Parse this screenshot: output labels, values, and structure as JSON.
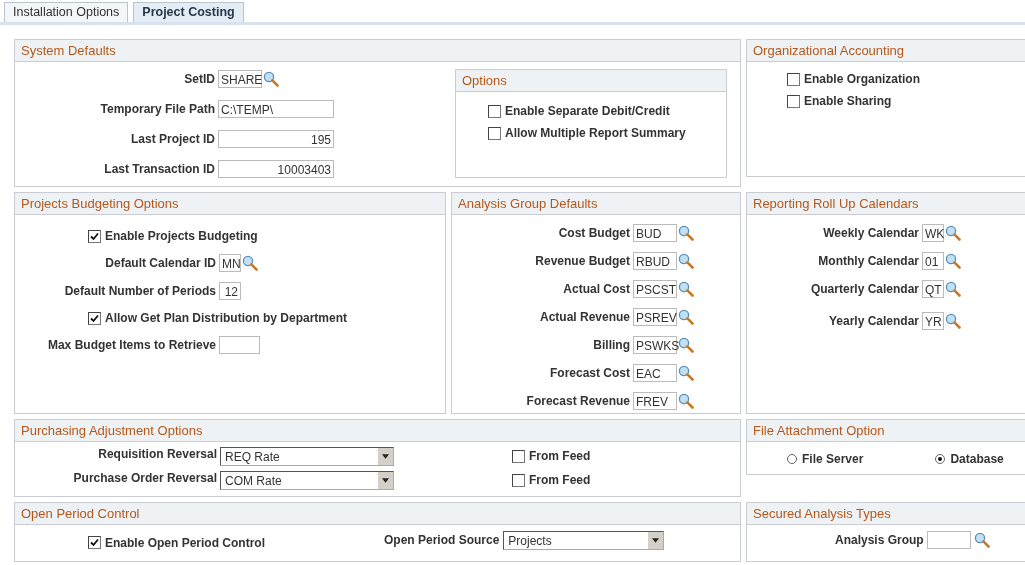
{
  "tabs": [
    {
      "label": "Installation Options",
      "selected": false
    },
    {
      "label": "Project Costing",
      "selected": true
    }
  ],
  "system_defaults": {
    "title": "System Defaults",
    "fields": [
      {
        "label": "SetID",
        "value": "SHARE",
        "kind": "lookup"
      },
      {
        "label": "Temporary File Path",
        "value": "C:\\TEMP\\",
        "kind": "text"
      },
      {
        "label": "Last Project ID",
        "value": "195",
        "kind": "number"
      },
      {
        "label": "Last Transaction ID",
        "value": "10003403",
        "kind": "number"
      }
    ],
    "options": {
      "title": "Options",
      "checkboxes": [
        {
          "label": "Enable Separate Debit/Credit",
          "checked": false
        },
        {
          "label": "Allow Multiple Report Summary",
          "checked": false
        }
      ]
    }
  },
  "organizational_accounting": {
    "title": "Organizational Accounting",
    "checkboxes": [
      {
        "label": "Enable Organization",
        "checked": false
      },
      {
        "label": "Enable Sharing",
        "checked": false
      }
    ]
  },
  "projects_budgeting": {
    "title": "Projects Budgeting Options",
    "items": [
      {
        "kind": "checkbox",
        "label": "Enable Projects Budgeting",
        "checked": true
      },
      {
        "kind": "lookup",
        "label": "Default Calendar ID",
        "value": "MN"
      },
      {
        "kind": "number",
        "label": "Default Number of Periods",
        "value": "12"
      },
      {
        "kind": "checkbox",
        "label": "Allow Get Plan Distribution by Department",
        "checked": true
      },
      {
        "kind": "text",
        "label": "Max Budget Items to Retrieve"
      }
    ]
  },
  "analysis_group_defaults": {
    "title": "Analysis Group Defaults",
    "fields": [
      {
        "label": "Cost Budget",
        "value": "BUD"
      },
      {
        "label": "Revenue Budget",
        "value": "RBUD"
      },
      {
        "label": "Actual Cost",
        "value": "PSCST"
      },
      {
        "label": "Actual Revenue",
        "value": "PSREV"
      },
      {
        "label": "Billing",
        "value": "PSWKS"
      },
      {
        "label": "Forecast Cost",
        "value": "EAC"
      },
      {
        "label": "Forecast Revenue",
        "value": "FREV"
      }
    ]
  },
  "reporting_roll_up_calendars": {
    "title": "Reporting Roll Up Calendars",
    "fields": [
      {
        "label": "Weekly Calendar",
        "value": "WK"
      },
      {
        "label": "Monthly Calendar",
        "value": "01"
      },
      {
        "label": "Quarterly Calendar",
        "value": "QT"
      },
      {
        "label": "Yearly Calendar",
        "value": "YR"
      }
    ]
  },
  "purchasing_adjustment": {
    "title": "Purchasing Adjustment Options",
    "rows": [
      {
        "label": "Requisition Reversal",
        "value": "REQ Rate",
        "from_feed": {
          "label": "From Feed",
          "checked": false
        }
      },
      {
        "label": "Purchase Order Reversal",
        "value": "COM Rate",
        "from_feed": {
          "label": "From Feed",
          "checked": false
        }
      }
    ]
  },
  "file_attachment": {
    "title": "File Attachment Option",
    "options": [
      {
        "label": "File Server",
        "selected": false
      },
      {
        "label": "Database",
        "selected": true
      }
    ]
  },
  "open_period_control": {
    "title": "Open Period Control",
    "checkbox": {
      "label": "Enable Open Period Control",
      "checked": true
    },
    "source": {
      "label": "Open Period Source",
      "value": "Projects"
    }
  },
  "secured_analysis_types": {
    "title": "Secured Analysis Types",
    "field": {
      "label": "Analysis Group"
    }
  }
}
